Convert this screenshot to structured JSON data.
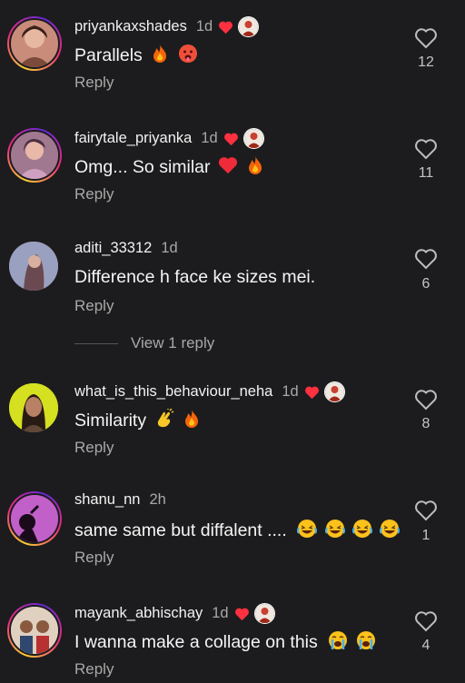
{
  "comments": [
    {
      "username": "priyankaxshades",
      "time": "1d",
      "text": "Parallels",
      "reply": "Reply",
      "likes": "12",
      "creator_liked": true,
      "ring": true,
      "emojis": [
        "fire-emoji",
        "hot-face-emoji"
      ],
      "avatar_color": "#c98c7a"
    },
    {
      "username": "fairytale_priyanka",
      "time": "1d",
      "text": "Omg... So similar",
      "reply": "Reply",
      "likes": "11",
      "creator_liked": true,
      "ring": true,
      "emojis": [
        "red-heart-emoji",
        "fire-emoji"
      ],
      "avatar_color": "#8e6a8e"
    },
    {
      "username": "aditi_33312",
      "time": "1d",
      "text": "Difference h face ke sizes mei.",
      "reply": "Reply",
      "likes": "6",
      "creator_liked": false,
      "ring": false,
      "emojis": [],
      "avatar_color": "#8a8ea8"
    },
    {
      "username": "what_is_this_behaviour_neha",
      "time": "1d",
      "text": "Similarity",
      "reply": "Reply",
      "likes": "8",
      "creator_liked": true,
      "ring": false,
      "emojis": [
        "clapping-hands-emoji",
        "fire-emoji"
      ],
      "avatar_color": "#c8d820"
    },
    {
      "username": "shanu_nn",
      "time": "2h",
      "text": "same same but diffalent ....",
      "reply": "Reply",
      "likes": "1",
      "creator_liked": false,
      "ring": true,
      "emojis": [
        "laughing-emoji",
        "laughing-emoji",
        "laughing-emoji",
        "laughing-emoji"
      ],
      "avatar_color": "#b050b8"
    },
    {
      "username": "mayank_abhischay",
      "time": "1d",
      "text": "I wanna make a collage on this",
      "reply": "Reply",
      "likes": "4",
      "creator_liked": true,
      "ring": true,
      "emojis": [
        "crying-emoji",
        "crying-emoji"
      ],
      "avatar_color": "#d8c8b8"
    }
  ],
  "view_replies": "View 1 reply",
  "colors": {
    "background": "#1c1c1e",
    "heart": "#ff3040",
    "muted": "#a8a8a8"
  }
}
